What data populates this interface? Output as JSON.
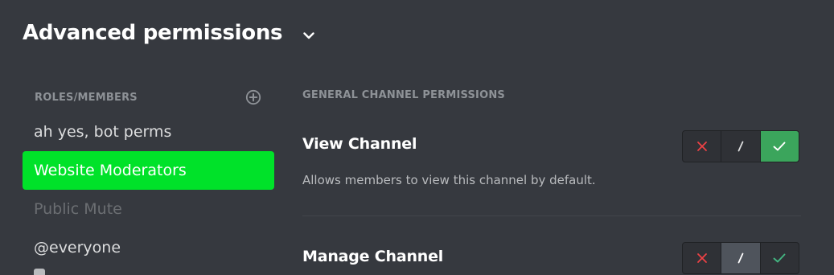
{
  "section": {
    "title": "Advanced permissions",
    "toggle_icon": "chevron-down-icon"
  },
  "roles": {
    "header": "ROLES/MEMBERS",
    "add_icon": "add-circle-icon",
    "items": [
      {
        "label": "ah yes, bot perms",
        "state": "normal"
      },
      {
        "label": "Website Moderators",
        "state": "selected"
      },
      {
        "label": "Public Mute",
        "state": "muted"
      },
      {
        "label": "@everyone",
        "state": "normal"
      }
    ]
  },
  "permissions": {
    "group_title": "GENERAL CHANNEL PERMISSIONS",
    "items": [
      {
        "name": "View Channel",
        "description": "Allows members to view this channel by default.",
        "value": "allow"
      },
      {
        "name": "Manage Channel",
        "description": "",
        "value": "neutral"
      }
    ],
    "toggle_labels": {
      "deny": "×",
      "neutral": "/",
      "allow": "✓"
    }
  },
  "colors": {
    "background": "#36393f",
    "selected_role": "#00e229",
    "deny": "#ed4245",
    "allow": "#3ba55c",
    "allow_inactive": "#43b581",
    "muted_text": "#8e9297"
  }
}
